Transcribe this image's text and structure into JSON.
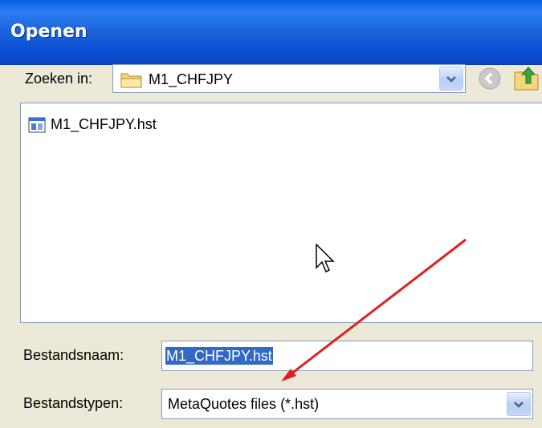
{
  "dialog": {
    "title": "Openen"
  },
  "look_in": {
    "label": "Zoeken in:",
    "value": "M1_CHFJPY",
    "icon": "folder-icon"
  },
  "toolbar": {
    "back_icon": "back-icon",
    "up_icon": "up-folder-icon"
  },
  "files": [
    {
      "name": "M1_CHFJPY.hst",
      "icon": "hst-file-icon"
    }
  ],
  "file_name": {
    "label": "Bestandsnaam:",
    "value": "M1_CHFJPY.hst"
  },
  "file_type": {
    "label": "Bestandstypen:",
    "value": "MetaQuotes files (*.hst)"
  },
  "annotation": {
    "color": "#e02020"
  }
}
